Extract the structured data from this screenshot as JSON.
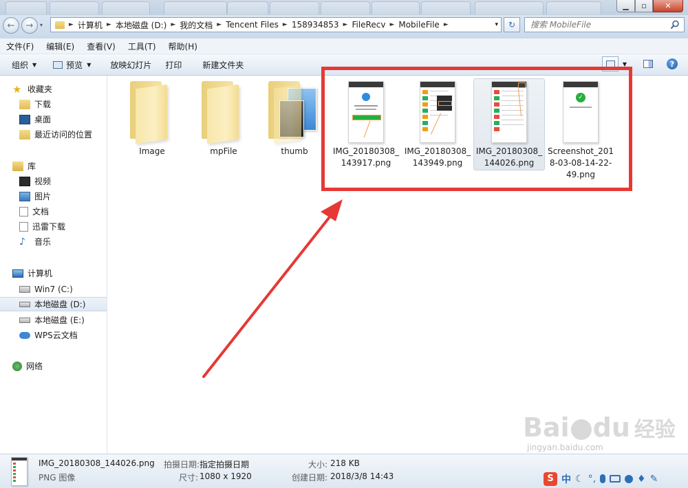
{
  "window": {
    "min_symbol": "▁",
    "max_symbol": "▫",
    "close_symbol": "✕"
  },
  "address": {
    "back_icon": "←",
    "forward_icon": "→",
    "crumbs": [
      "计算机",
      "本地磁盘 (D:)",
      "我的文档",
      "Tencent Files",
      "158934853",
      "FileRecv",
      "MobileFile"
    ],
    "dropdown_arrow": "▾",
    "refresh_symbol": "↻",
    "search_placeholder": "搜索 MobileFile"
  },
  "menu": [
    "文件(F)",
    "编辑(E)",
    "查看(V)",
    "工具(T)",
    "帮助(H)"
  ],
  "toolbar": {
    "organize": "组织",
    "preview": "预览",
    "slideshow": "放映幻灯片",
    "print": "打印",
    "new_folder": "新建文件夹"
  },
  "nav": {
    "favorites": {
      "label": "收藏夹",
      "items": [
        "下载",
        "桌面",
        "最近访问的位置"
      ]
    },
    "libraries": {
      "label": "库",
      "items": [
        "视频",
        "图片",
        "文档",
        "迅雷下载",
        "音乐"
      ]
    },
    "computer": {
      "label": "计算机",
      "items": [
        "Win7 (C:)",
        "本地磁盘 (D:)",
        "本地磁盘 (E:)",
        "WPS云文档"
      ]
    },
    "network": {
      "label": "网络"
    }
  },
  "files": [
    {
      "name": "Image",
      "type": "folder"
    },
    {
      "name": "mpFile",
      "type": "folder"
    },
    {
      "name": "thumb",
      "type": "folder"
    },
    {
      "name": "IMG_20180308_143917.png",
      "line1": "IMG_20180308_",
      "line2": "143917.png",
      "type": "image"
    },
    {
      "name": "IMG_20180308_143949.png",
      "line1": "IMG_20180308_",
      "line2": "143949.png",
      "type": "image"
    },
    {
      "name": "IMG_20180308_144026.png",
      "line1": "IMG_20180308_",
      "line2": "144026.png",
      "type": "image",
      "selected": true
    },
    {
      "name": "Screenshot_2018-03-08-14-22-49.png",
      "line1": "Screenshot_201",
      "line2": "8-03-08-14-22-",
      "line3": "49.png",
      "type": "image"
    }
  ],
  "status": {
    "filename": "IMG_20180308_144026.png",
    "filetype": "PNG 图像",
    "shot_date_key": "拍摄日期:",
    "shot_date_val": "指定拍摄日期",
    "dimensions_key": "尺寸:",
    "dimensions_val": "1080 x 1920",
    "size_key": "大小:",
    "size_val": "218 KB",
    "created_key": "创建日期:",
    "created_val": "2018/3/8 14:43"
  },
  "watermark": {
    "brand": "Bai",
    "brand2": "du",
    "cn": "经验",
    "url": "jingyan.baidu.com"
  },
  "ime": {
    "lang": "中"
  },
  "colors": {
    "highlight": "#e53935",
    "accent": "#2d6eb7"
  }
}
